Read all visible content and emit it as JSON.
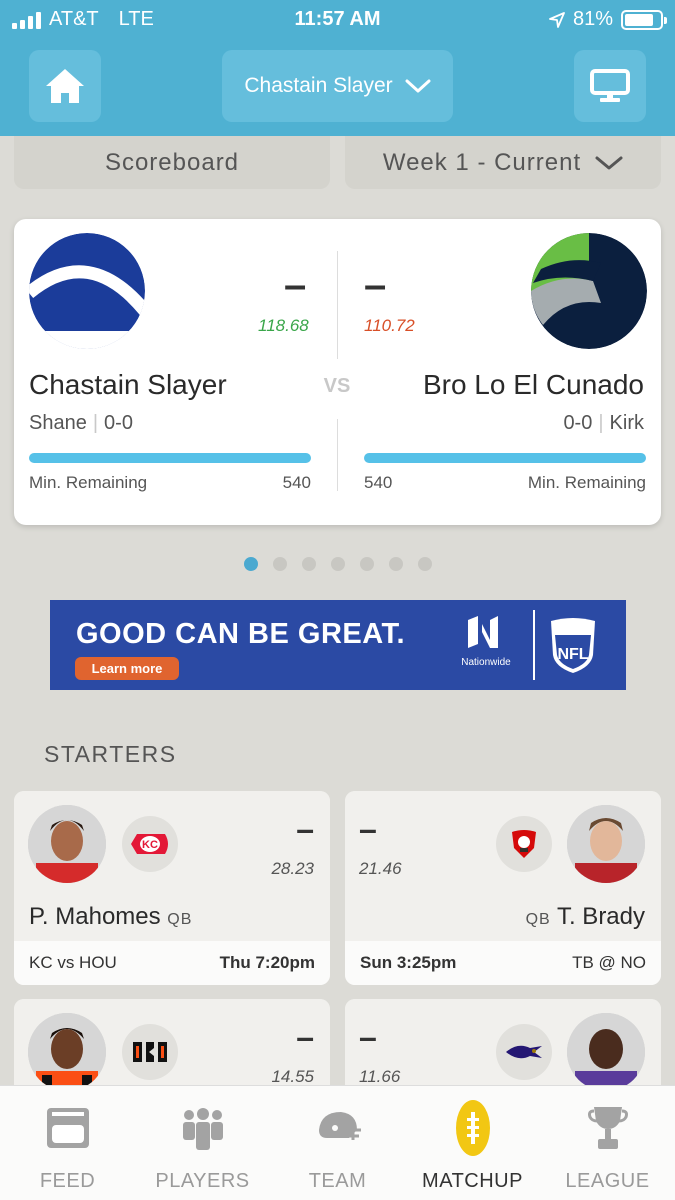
{
  "status_bar": {
    "carrier": "AT&T",
    "network": "LTE",
    "time": "11:57 AM",
    "battery": "81%"
  },
  "header": {
    "team_selector": "Chastain Slayer"
  },
  "selector": {
    "left": "Scoreboard",
    "right": "Week 1 - Current"
  },
  "matchup": {
    "home": {
      "name": "Chastain Slayer",
      "owner": "Shane",
      "record": "0-0",
      "score": "–",
      "projected": "118.68",
      "min_label": "Min. Remaining",
      "min_value": "540"
    },
    "vs": "VS",
    "away": {
      "name": "Bro Lo El Cunado",
      "owner": "Kirk",
      "record": "0-0",
      "score": "–",
      "projected": "110.72",
      "min_label": "Min. Remaining",
      "min_value": "540"
    },
    "page_dots": 7,
    "active_dot": 0
  },
  "ad": {
    "headline": "GOOD CAN BE GREAT.",
    "cta": "Learn more",
    "sponsor": "Nationwide",
    "league": "NFL"
  },
  "section_title": "STARTERS",
  "starters": [
    {
      "side": "left",
      "name": "P. Mahomes",
      "pos": "QB",
      "score": "–",
      "projected": "28.23",
      "matchup": "KC vs HOU",
      "kickoff": "Thu 7:20pm",
      "team": "KC"
    },
    {
      "side": "right",
      "name": "T. Brady",
      "pos": "QB",
      "score": "–",
      "projected": "21.46",
      "matchup": "TB @ NO",
      "kickoff": "Sun 3:25pm",
      "team": "TB"
    },
    {
      "side": "left",
      "score": "–",
      "projected": "14.55",
      "team": "CIN"
    },
    {
      "side": "right",
      "score": "–",
      "projected": "11.66",
      "team": "BAL"
    }
  ],
  "nav": [
    {
      "label": "FEED",
      "icon": "feed-icon",
      "active": false
    },
    {
      "label": "PLAYERS",
      "icon": "players-icon",
      "active": false
    },
    {
      "label": "TEAM",
      "icon": "helmet-icon",
      "active": false
    },
    {
      "label": "MATCHUP",
      "icon": "football-icon",
      "active": true
    },
    {
      "label": "LEAGUE",
      "icon": "trophy-icon",
      "active": false
    }
  ],
  "colors": {
    "header": "#4fb1d2",
    "accent_blue": "#56c1e8",
    "green": "#3aa64a",
    "red": "#d84f27",
    "ad_blue": "#2b4aa4"
  }
}
